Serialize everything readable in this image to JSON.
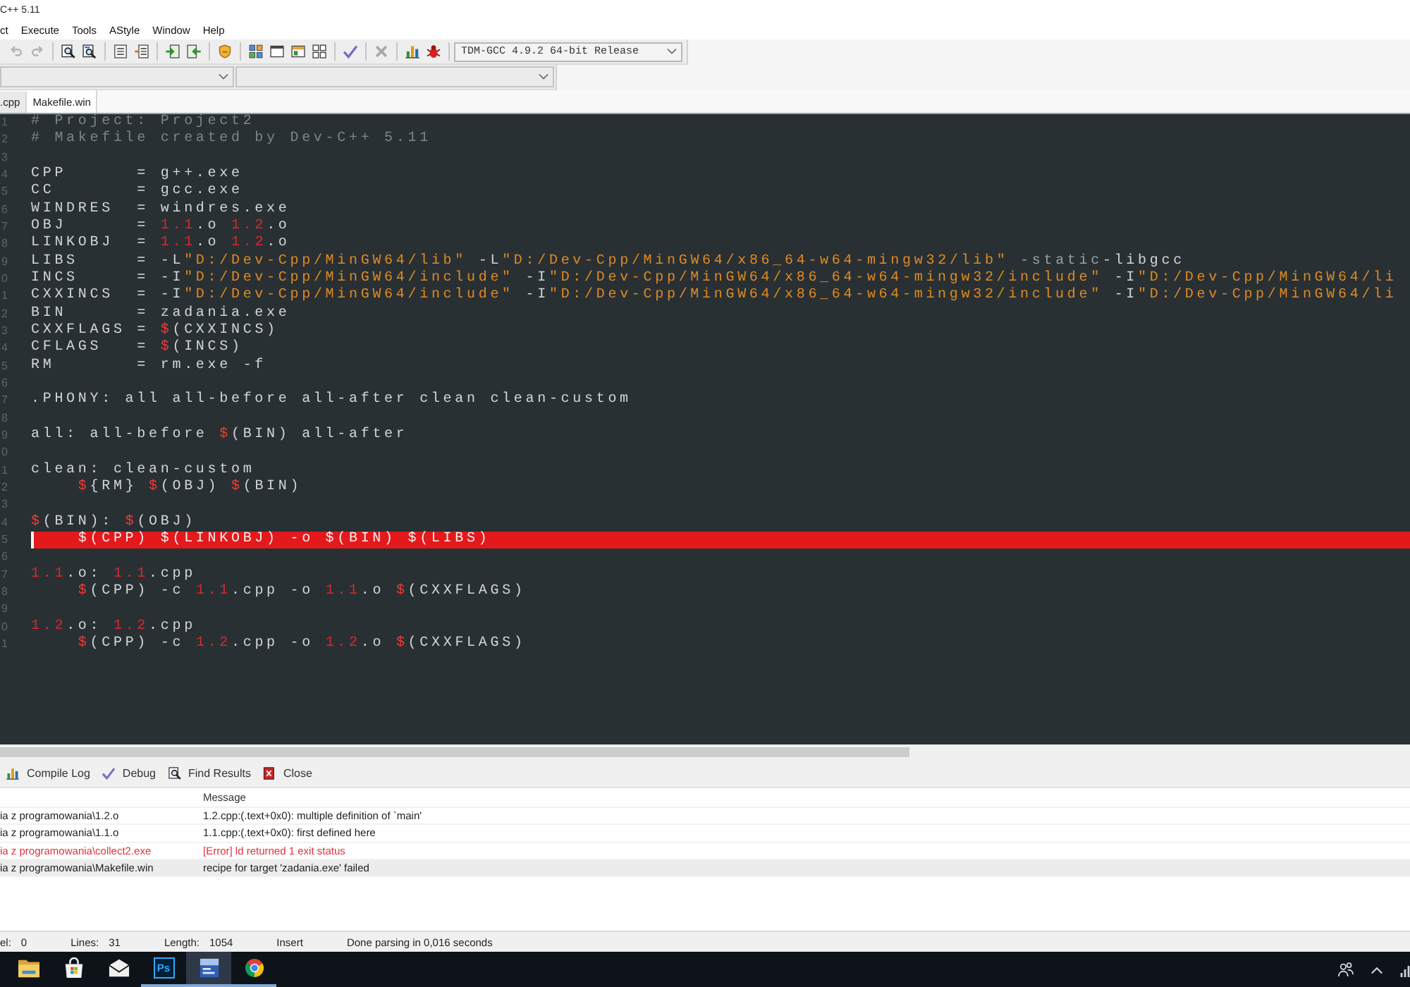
{
  "window": {
    "title": "C++ 5.11"
  },
  "menu": [
    "ct",
    "Execute",
    "Tools",
    "AStyle",
    "Window",
    "Help"
  ],
  "toolbar": {
    "groups": [
      [
        {
          "kind": "undo",
          "disabled": true
        },
        {
          "kind": "redo",
          "disabled": true
        }
      ],
      [
        {
          "kind": "find",
          "disabled": false
        },
        {
          "kind": "replace",
          "disabled": false
        }
      ],
      [
        {
          "kind": "lines",
          "disabled": false
        },
        {
          "kind": "indent",
          "disabled": false
        }
      ],
      [
        {
          "kind": "compile",
          "disabled": false
        },
        {
          "kind": "run",
          "disabled": false
        }
      ],
      [
        {
          "kind": "shield",
          "disabled": false
        }
      ],
      [
        {
          "kind": "grid",
          "disabled": false
        },
        {
          "kind": "window",
          "disabled": false
        },
        {
          "kind": "panel",
          "disabled": false
        },
        {
          "kind": "tiles",
          "disabled": false
        }
      ],
      [
        {
          "kind": "check",
          "disabled": false
        }
      ],
      [
        {
          "kind": "cross",
          "disabled": true
        }
      ],
      [
        {
          "kind": "chart",
          "disabled": false
        },
        {
          "kind": "bug",
          "disabled": false
        }
      ]
    ],
    "compiler": "TDM-GCC 4.9.2 64-bit Release"
  },
  "file_tabs": [
    {
      "label": ".cpp",
      "selected": false
    },
    {
      "label": "Makefile.win",
      "selected": true
    }
  ],
  "editor": {
    "lines": [
      {
        "number": "1",
        "highlighted": false,
        "caret": false,
        "tokens": [
          {
            "kind": "comment",
            "text": "# Project: Project2"
          }
        ]
      },
      {
        "number": "2",
        "highlighted": false,
        "caret": false,
        "tokens": [
          {
            "kind": "comment",
            "text": "# Makefile created by Dev-C++ 5.11"
          }
        ]
      },
      {
        "number": "3",
        "highlighted": false,
        "caret": false
      },
      {
        "number": "4",
        "highlighted": false,
        "caret": false,
        "tokens": [
          {
            "kind": "plain",
            "text": "CPP      = g++.exe"
          }
        ]
      },
      {
        "number": "5",
        "highlighted": false,
        "caret": false,
        "tokens": [
          {
            "kind": "plain",
            "text": "CC       = gcc.exe"
          }
        ]
      },
      {
        "number": "6",
        "highlighted": false,
        "caret": false,
        "tokens": [
          {
            "kind": "plain",
            "text": "WINDRES  = windres.exe"
          }
        ]
      },
      {
        "number": "7",
        "highlighted": false,
        "caret": false,
        "tokens": [
          {
            "kind": "plain",
            "text": "OBJ      = "
          },
          {
            "kind": "number",
            "text": "1.1"
          },
          {
            "kind": "plain",
            "text": ".o "
          },
          {
            "kind": "number",
            "text": "1.2"
          },
          {
            "kind": "plain",
            "text": ".o"
          }
        ]
      },
      {
        "number": "8",
        "highlighted": false,
        "caret": false,
        "tokens": [
          {
            "kind": "plain",
            "text": "LINKOBJ  = "
          },
          {
            "kind": "number",
            "text": "1.1"
          },
          {
            "kind": "plain",
            "text": ".o "
          },
          {
            "kind": "number",
            "text": "1.2"
          },
          {
            "kind": "plain",
            "text": ".o"
          }
        ]
      },
      {
        "number": "9",
        "highlighted": false,
        "caret": false,
        "tokens": [
          {
            "kind": "plain",
            "text": "LIBS     = -L"
          },
          {
            "kind": "string",
            "text": "\"D:/Dev-Cpp/MinGW64/lib\""
          },
          {
            "kind": "plain",
            "text": " -L"
          },
          {
            "kind": "string",
            "text": "\"D:/Dev-Cpp/MinGW64/x86_64-w64-mingw32/lib\""
          },
          {
            "kind": "option",
            "text": " -static"
          },
          {
            "kind": "plain",
            "text": "-libgcc"
          }
        ]
      },
      {
        "number": "0",
        "highlighted": false,
        "caret": false,
        "tokens": [
          {
            "kind": "plain",
            "text": "INCS     = -I"
          },
          {
            "kind": "string",
            "text": "\"D:/Dev-Cpp/MinGW64/include\""
          },
          {
            "kind": "plain",
            "text": " -I"
          },
          {
            "kind": "string",
            "text": "\"D:/Dev-Cpp/MinGW64/x86_64-w64-mingw32/include\""
          },
          {
            "kind": "plain",
            "text": " -I"
          },
          {
            "kind": "string",
            "text": "\"D:/Dev-Cpp/MinGW64/li"
          }
        ]
      },
      {
        "number": "1",
        "highlighted": false,
        "caret": false,
        "tokens": [
          {
            "kind": "plain",
            "text": "CXXINCS  = -I"
          },
          {
            "kind": "string",
            "text": "\"D:/Dev-Cpp/MinGW64/include\""
          },
          {
            "kind": "plain",
            "text": " -I"
          },
          {
            "kind": "string",
            "text": "\"D:/Dev-Cpp/MinGW64/x86_64-w64-mingw32/include\""
          },
          {
            "kind": "plain",
            "text": " -I"
          },
          {
            "kind": "string",
            "text": "\"D:/Dev-Cpp/MinGW64/li"
          }
        ]
      },
      {
        "number": "2",
        "highlighted": false,
        "caret": false,
        "tokens": [
          {
            "kind": "plain",
            "text": "BIN      = zadania.exe"
          }
        ]
      },
      {
        "number": "3",
        "highlighted": false,
        "caret": false,
        "tokens": [
          {
            "kind": "plain",
            "text": "CXXFLAGS = "
          },
          {
            "kind": "variable",
            "text": "$"
          },
          {
            "kind": "plain",
            "text": "(CXXINCS)"
          }
        ]
      },
      {
        "number": "4",
        "highlighted": false,
        "caret": false,
        "tokens": [
          {
            "kind": "plain",
            "text": "CFLAGS   = "
          },
          {
            "kind": "variable",
            "text": "$"
          },
          {
            "kind": "plain",
            "text": "(INCS)"
          }
        ]
      },
      {
        "number": "5",
        "highlighted": false,
        "caret": false,
        "tokens": [
          {
            "kind": "plain",
            "text": "RM       = rm.exe -f"
          }
        ]
      },
      {
        "number": "6",
        "highlighted": false,
        "caret": false
      },
      {
        "number": "7",
        "highlighted": false,
        "caret": false,
        "tokens": [
          {
            "kind": "plain",
            "text": ".PHONY: all all-before all-after clean clean-custom"
          }
        ]
      },
      {
        "number": "8",
        "highlighted": false,
        "caret": false
      },
      {
        "number": "9",
        "highlighted": false,
        "caret": false,
        "tokens": [
          {
            "kind": "plain",
            "text": "all: all-before "
          },
          {
            "kind": "variable",
            "text": "$"
          },
          {
            "kind": "plain",
            "text": "(BIN) all-after"
          }
        ]
      },
      {
        "number": "0",
        "highlighted": false,
        "caret": false
      },
      {
        "number": "1",
        "highlighted": false,
        "caret": false,
        "tokens": [
          {
            "kind": "plain",
            "text": "clean: clean-custom"
          }
        ]
      },
      {
        "number": "2",
        "highlighted": false,
        "caret": false,
        "tokens": [
          {
            "kind": "variable",
            "text": "    $"
          },
          {
            "kind": "plain",
            "text": "{RM} "
          },
          {
            "kind": "variable",
            "text": "$"
          },
          {
            "kind": "plain",
            "text": "(OBJ) "
          },
          {
            "kind": "variable",
            "text": "$"
          },
          {
            "kind": "plain",
            "text": "(BIN)"
          }
        ]
      },
      {
        "number": "3",
        "highlighted": false,
        "caret": false
      },
      {
        "number": "4",
        "highlighted": false,
        "caret": false,
        "tokens": [
          {
            "kind": "variable",
            "text": "$"
          },
          {
            "kind": "plain",
            "text": "(BIN): "
          },
          {
            "kind": "variable",
            "text": "$"
          },
          {
            "kind": "plain",
            "text": "(OBJ)"
          }
        ]
      },
      {
        "number": "5",
        "highlighted": true,
        "caret": true,
        "tokens": [
          {
            "kind": "plain",
            "text": "    $(CPP) $(LINKOBJ) -o $(BIN) $(LIBS)"
          }
        ]
      },
      {
        "number": "6",
        "highlighted": false,
        "caret": false
      },
      {
        "number": "7",
        "highlighted": false,
        "caret": false,
        "tokens": [
          {
            "kind": "number",
            "text": "1.1"
          },
          {
            "kind": "plain",
            "text": ".o: "
          },
          {
            "kind": "number",
            "text": "1.1"
          },
          {
            "kind": "plain",
            "text": ".cpp"
          }
        ]
      },
      {
        "number": "8",
        "highlighted": false,
        "caret": false,
        "tokens": [
          {
            "kind": "variable",
            "text": "    $"
          },
          {
            "kind": "plain",
            "text": "(CPP) -c "
          },
          {
            "kind": "number",
            "text": "1.1"
          },
          {
            "kind": "plain",
            "text": ".cpp -o "
          },
          {
            "kind": "number",
            "text": "1.1"
          },
          {
            "kind": "plain",
            "text": ".o "
          },
          {
            "kind": "variable",
            "text": "$"
          },
          {
            "kind": "plain",
            "text": "(CXXFLAGS)"
          }
        ]
      },
      {
        "number": "9",
        "highlighted": false,
        "caret": false
      },
      {
        "number": "0",
        "highlighted": false,
        "caret": false,
        "tokens": [
          {
            "kind": "number",
            "text": "1.2"
          },
          {
            "kind": "plain",
            "text": ".o: "
          },
          {
            "kind": "number",
            "text": "1.2"
          },
          {
            "kind": "plain",
            "text": ".cpp"
          }
        ]
      },
      {
        "number": "1",
        "highlighted": false,
        "caret": false,
        "tokens": [
          {
            "kind": "variable",
            "text": "    $"
          },
          {
            "kind": "plain",
            "text": "(CPP) -c "
          },
          {
            "kind": "number",
            "text": "1.2"
          },
          {
            "kind": "plain",
            "text": ".cpp -o "
          },
          {
            "kind": "number",
            "text": "1.2"
          },
          {
            "kind": "plain",
            "text": ".o "
          },
          {
            "kind": "variable",
            "text": "$"
          },
          {
            "kind": "plain",
            "text": "(CXXFLAGS)"
          }
        ]
      }
    ]
  },
  "bottom_tabs": [
    {
      "label": "Compile Log",
      "kind": "log",
      "selected": false
    },
    {
      "label": "Debug",
      "kind": "debug",
      "selected": false
    },
    {
      "label": "Find Results",
      "kind": "find",
      "selected": false
    },
    {
      "label": "Close",
      "kind": "close",
      "selected": false
    }
  ],
  "messages": {
    "heading": "Message",
    "rows": [
      {
        "column_1": "ia z programowania\\1.2.o",
        "message": "1.2.cpp:(.text+0x0): multiple definition of `main'",
        "error": false,
        "selected": false
      },
      {
        "column_1": "ia z programowania\\1.1.o",
        "message": "1.1.cpp:(.text+0x0): first defined here",
        "error": false,
        "selected": false
      },
      {
        "column_1": "ia z programowania\\collect2.exe",
        "message": "[Error] ld returned 1 exit status",
        "error": true,
        "selected": false
      },
      {
        "column_1": "ia z programowania\\Makefile.win",
        "message": "recipe for target 'zadania.exe' failed",
        "error": false,
        "selected": true
      }
    ]
  },
  "status_bar": {
    "fields": [
      {
        "label": "el:",
        "value": "0"
      },
      {
        "label": "Lines:",
        "value": "31"
      },
      {
        "label": "Length:",
        "value": "1054"
      }
    ],
    "mode": "Insert",
    "message": "Done parsing in 0,016 seconds"
  },
  "taskbar": {
    "apps": [
      {
        "kind": "folder",
        "running": false,
        "active": false
      },
      {
        "kind": "store",
        "running": false,
        "active": false
      },
      {
        "kind": "mail",
        "running": false,
        "active": false
      },
      {
        "kind": "lettered",
        "label": "Ps",
        "running": true,
        "active": false
      },
      {
        "kind": "ide",
        "running": true,
        "active": true
      },
      {
        "kind": "browser",
        "running": true,
        "active": false
      }
    ]
  }
}
